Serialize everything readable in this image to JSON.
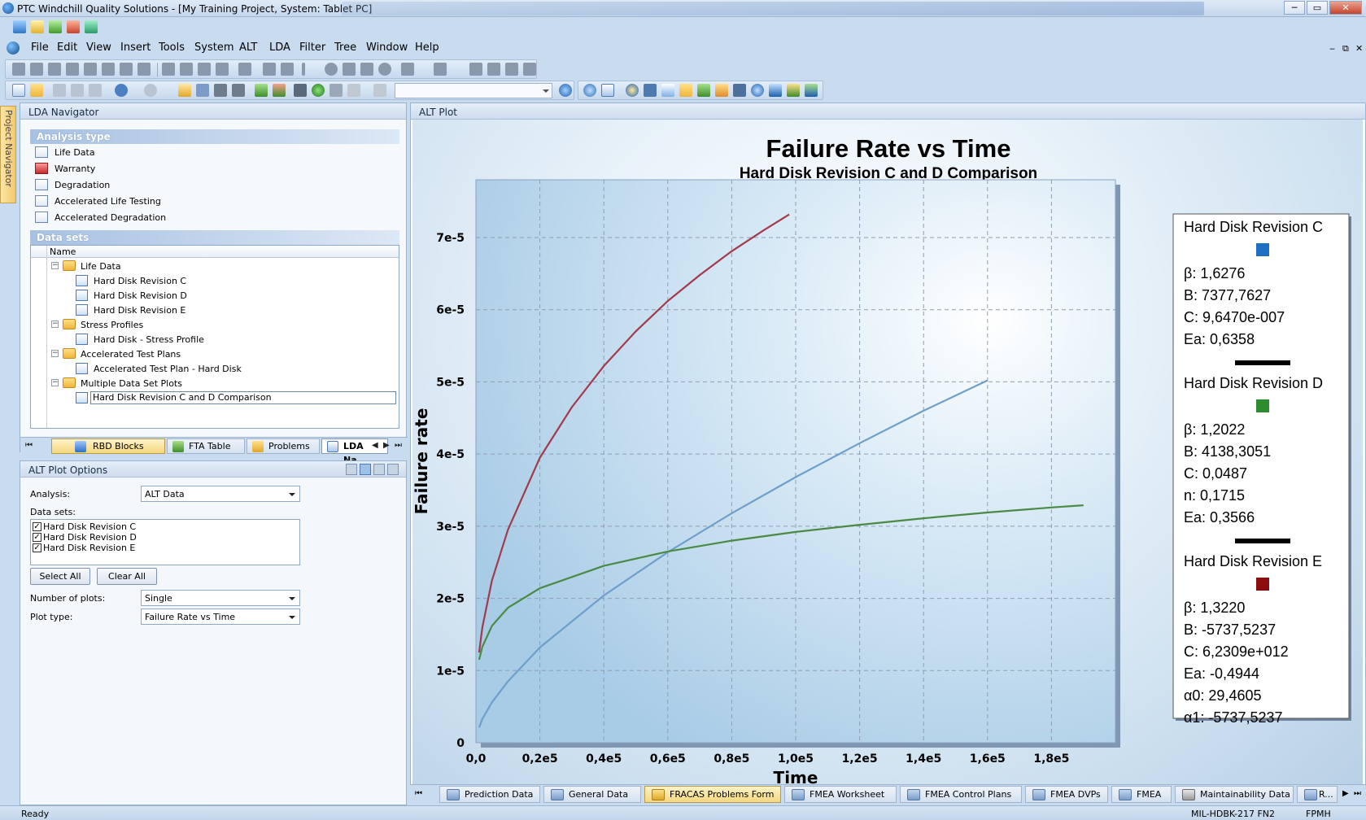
{
  "window": {
    "title": "PTC Windchill Quality Solutions - [My Training Project, System: Tablet PC]",
    "controls": {
      "minimize": "─",
      "restore": "▭",
      "close": "✕"
    }
  },
  "menu": [
    "File",
    "Edit",
    "View",
    "Insert",
    "Tools",
    "System",
    "ALT",
    "LDA",
    "Filter",
    "Tree",
    "Window",
    "Help"
  ],
  "mdi_controls": {
    "minimize": "‒",
    "restore": "⧉",
    "close": "✕"
  },
  "lda_navigator": {
    "title": "LDA Navigator",
    "analysis_type_header": "Analysis type",
    "analysis_types": [
      "Life Data",
      "Warranty",
      "Degradation",
      "Accelerated Life Testing",
      "Accelerated Degradation"
    ],
    "datasets_header": "Data sets",
    "tree_column": "Name",
    "tree": {
      "life_data": "Life Data",
      "rev_c": "Hard Disk Revision C",
      "rev_d": "Hard Disk Revision D",
      "rev_e": "Hard Disk Revision E",
      "stress_profiles": "Stress Profiles",
      "stress_profile": "Hard Disk - Stress Profile",
      "test_plans": "Accelerated Test Plans",
      "test_plan": "Accelerated Test Plan - Hard Disk",
      "multi_plots": "Multiple Data Set Plots",
      "comparison": "Hard Disk Revision C and D Comparison"
    },
    "tabs": [
      "RBD Blocks",
      "FTA Table",
      "Problems",
      "LDA Na..."
    ],
    "tab_nav": {
      "first": "⏮",
      "prev": "◀",
      "next": "▶",
      "last": "⏭"
    }
  },
  "plot_options": {
    "title": "ALT Plot Options",
    "analysis_label": "Analysis:",
    "analysis_value": "ALT Data",
    "datasets_label": "Data sets:",
    "datasets": [
      "Hard Disk Revision C",
      "Hard Disk Revision D",
      "Hard Disk Revision E"
    ],
    "checkmark": "✓",
    "select_all": "Select All",
    "clear_all": "Clear All",
    "num_plots_label": "Number of plots:",
    "num_plots_value": "Single",
    "plot_type_label": "Plot type:",
    "plot_type_value": "Failure Rate vs Time"
  },
  "plot_panel_title": "ALT Plot",
  "chart_data": {
    "type": "line",
    "title": "Failure Rate vs Time",
    "subtitle": "Hard Disk Revision C and D Comparison",
    "xlabel": "Time",
    "ylabel": "Failure rate",
    "xlim": [
      0,
      200000
    ],
    "ylim": [
      0,
      7.8e-05
    ],
    "grid": true,
    "x_ticks": [
      "0,0",
      "0,2e5",
      "0,4e5",
      "0,6e5",
      "0,8e5",
      "1,0e5",
      "1,2e5",
      "1,4e5",
      "1,6e5",
      "1,8e5"
    ],
    "y_ticks": [
      "0",
      "1e-5",
      "2e-5",
      "3e-5",
      "4e-5",
      "5e-5",
      "6e-5",
      "7e-5"
    ],
    "legend_position": "right",
    "series": [
      {
        "name": "Hard Disk Revision C",
        "color": "#1e6fc4",
        "line_color": "#6f9fc9",
        "x": [
          1000,
          2000,
          5000,
          10000,
          20000,
          40000,
          60000,
          80000,
          100000,
          120000,
          140000,
          160000
        ],
        "y": [
          2.1e-06,
          3.3e-06,
          5.6e-06,
          8.5e-06,
          1.32e-05,
          2.04e-05,
          2.64e-05,
          3.18e-05,
          3.68e-05,
          4.15e-05,
          4.6e-05,
          5.02e-05
        ]
      },
      {
        "name": "Hard Disk Revision D",
        "color": "#2e8b2e",
        "line_color": "#4a8a45",
        "x": [
          1000,
          2000,
          5000,
          10000,
          20000,
          40000,
          60000,
          80000,
          100000,
          120000,
          140000,
          160000,
          180000,
          190000
        ],
        "y": [
          1.15e-05,
          1.33e-05,
          1.62e-05,
          1.87e-05,
          2.14e-05,
          2.45e-05,
          2.65e-05,
          2.8e-05,
          2.92e-05,
          3.02e-05,
          3.11e-05,
          3.19e-05,
          3.26e-05,
          3.29e-05
        ]
      },
      {
        "name": "Hard Disk Revision E",
        "color": "#8b0d0d",
        "line_color": "#a23a4c",
        "x": [
          1000,
          2000,
          5000,
          10000,
          20000,
          30000,
          40000,
          50000,
          60000,
          70000,
          80000,
          90000,
          98000
        ],
        "y": [
          1.25e-05,
          1.6e-05,
          2.25e-05,
          2.95e-05,
          3.95e-05,
          4.65e-05,
          5.22e-05,
          5.7e-05,
          6.12e-05,
          6.48e-05,
          6.81e-05,
          7.1e-05,
          7.32e-05
        ]
      }
    ],
    "legend": [
      {
        "name": "Hard Disk Revision C",
        "color": "#1e6fc4",
        "params": [
          "β: 1,6276",
          "B: 7377,7627",
          "C: 9,6470e-007",
          "Ea: 0,6358"
        ]
      },
      {
        "name": "Hard Disk Revision D",
        "color": "#2e8b2e",
        "params": [
          "β: 1,2022",
          "B: 4138,3051",
          "C: 0,0487",
          "n: 0,1715",
          "Ea: 0,3566"
        ]
      },
      {
        "name": "Hard Disk Revision E",
        "color": "#8b0d0d",
        "params": [
          "β: 1,3220",
          "B: -5737,5237",
          "C: 6,2309e+012",
          "Ea: -0,4944",
          "α0: 29,4605",
          "α1: -5737,5237"
        ]
      }
    ]
  },
  "bottom_tabs": [
    "Prediction Data",
    "General Data",
    "FRACAS Problems Form",
    "FMEA Worksheet",
    "FMEA Control Plans",
    "FMEA DVPs",
    "FMEA",
    "Maintainability Data",
    "R..."
  ],
  "status": {
    "left": "Ready",
    "standard": "MIL-HDBK-217 FN2",
    "units": "FPMH"
  },
  "project_navigator": "Project Navigator"
}
